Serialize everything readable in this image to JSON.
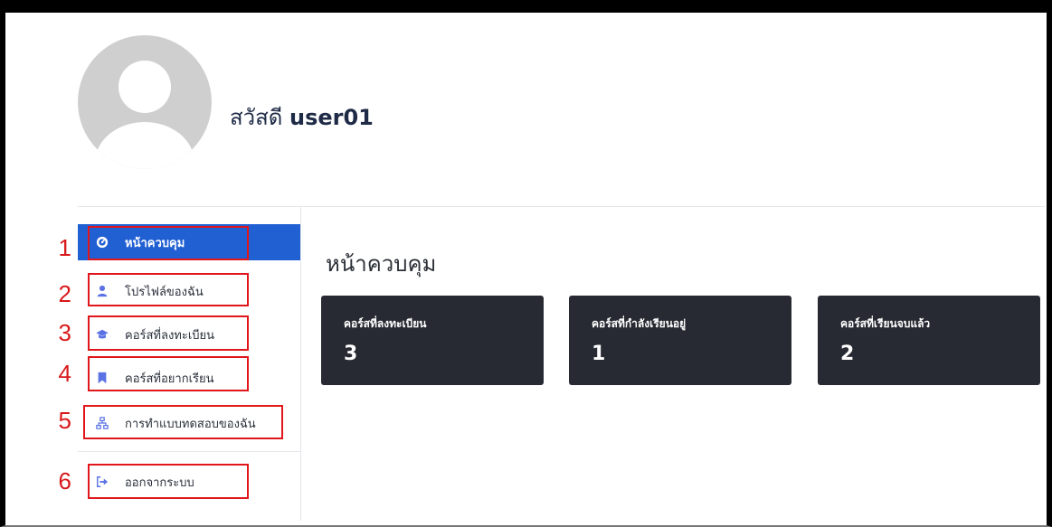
{
  "header": {
    "greeting": "สวัสดี",
    "username": "user01"
  },
  "sidebar": {
    "items": [
      {
        "label": "หน้าควบคุม",
        "icon": "dashboard-icon",
        "number": "1",
        "active": true
      },
      {
        "label": "โปรไฟล์ของฉัน",
        "icon": "user-icon",
        "number": "2"
      },
      {
        "label": "คอร์สที่ลงทะเบียน",
        "icon": "graduation-cap-icon",
        "number": "3"
      },
      {
        "label": "คอร์สที่อยากเรียน",
        "icon": "bookmark-icon",
        "number": "4"
      },
      {
        "label": "การทำแบบทดสอบของฉัน",
        "icon": "sitemap-icon",
        "number": "5"
      },
      {
        "label": "ออกจากระบบ",
        "icon": "sign-out-icon",
        "number": "6"
      }
    ]
  },
  "main": {
    "title": "หน้าควบคุม",
    "cards": [
      {
        "label": "คอร์สที่ลงทะเบียน",
        "value": "3"
      },
      {
        "label": "คอร์สที่กำลังเรียนอยู่",
        "value": "1"
      },
      {
        "label": "คอร์สที่เรียนจบแล้ว",
        "value": "2"
      }
    ]
  },
  "colors": {
    "active_bg": "#2160d3",
    "icon_color": "#5b72e4",
    "card_bg": "#272a32",
    "annotation_red": "#e0161b"
  }
}
